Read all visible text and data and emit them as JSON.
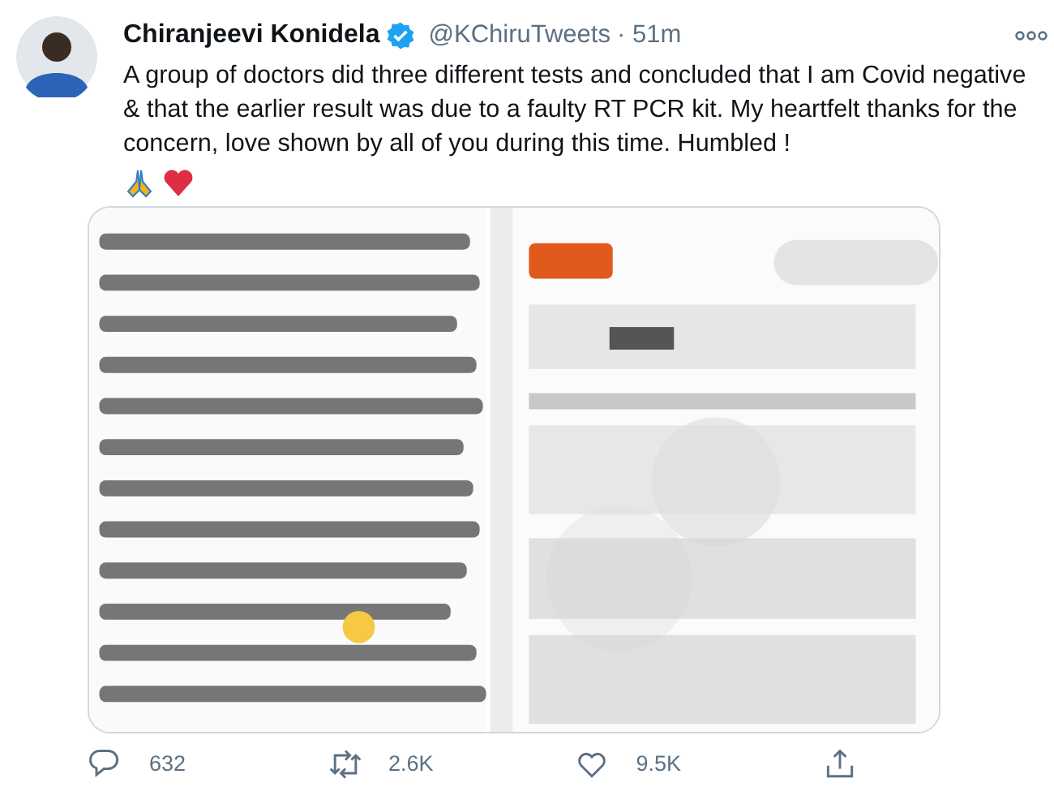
{
  "tweet": {
    "author": {
      "name": "Chiranjeevi Konidela",
      "verified": true,
      "handle": "@KChiruTweets",
      "time": "· 51m"
    },
    "text": "A group of doctors did three different tests and concluded that I am Covid negative & that the earlier result was due to a faulty RT PCR kit. My heartfelt thanks for the concern, love shown by all of you during this time. Humbled !",
    "actions": [
      {
        "kind": "reply",
        "count": "632"
      },
      {
        "kind": "retweet",
        "count": "2.6K"
      },
      {
        "kind": "like",
        "count": "9.5K"
      },
      {
        "kind": "share"
      }
    ]
  }
}
